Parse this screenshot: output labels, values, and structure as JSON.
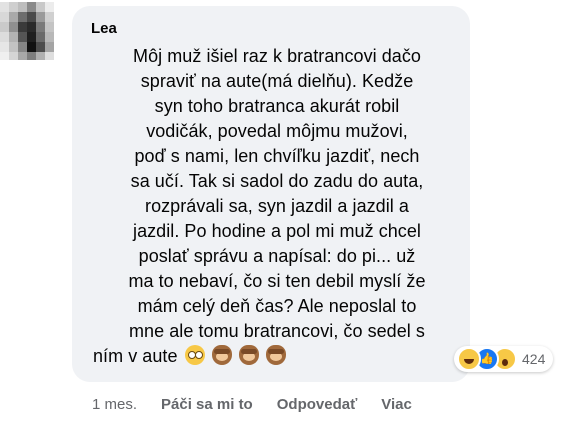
{
  "comment": {
    "author": "Lea",
    "lines": [
      "Môj muž išiel raz k bratrancovi dačo",
      "spraviť na aute(má dielňu). Kedže",
      "syn toho bratranca akurát robil",
      "vodičák, povedal môjmu mužovi,",
      "poď s nami, len chvíľku jazdiť, nech",
      "sa učí. Tak si sadol do zadu do auta,",
      "rozprávali sa, syn jazdil a jazdil a",
      "jazdil. Po hodine a pol mi muž chcel",
      "poslať správu a napísal: do pi... už",
      "ma to nebaví, čo si ten debil myslí že",
      "mám celý deň čas? Ale neposlal to",
      "mne ale tomu bratrancovi, čo sedel s",
      "ním v aute"
    ],
    "trailing_emojis": [
      "flushed-face",
      "see-no-evil-monkey",
      "see-no-evil-monkey",
      "see-no-evil-monkey"
    ],
    "reactions": {
      "icons": [
        "haha",
        "like",
        "wow"
      ],
      "count": "424"
    }
  },
  "actions": {
    "time": "1 mes.",
    "like": "Páči sa mi to",
    "reply": "Odpovedať",
    "more": "Viac"
  }
}
